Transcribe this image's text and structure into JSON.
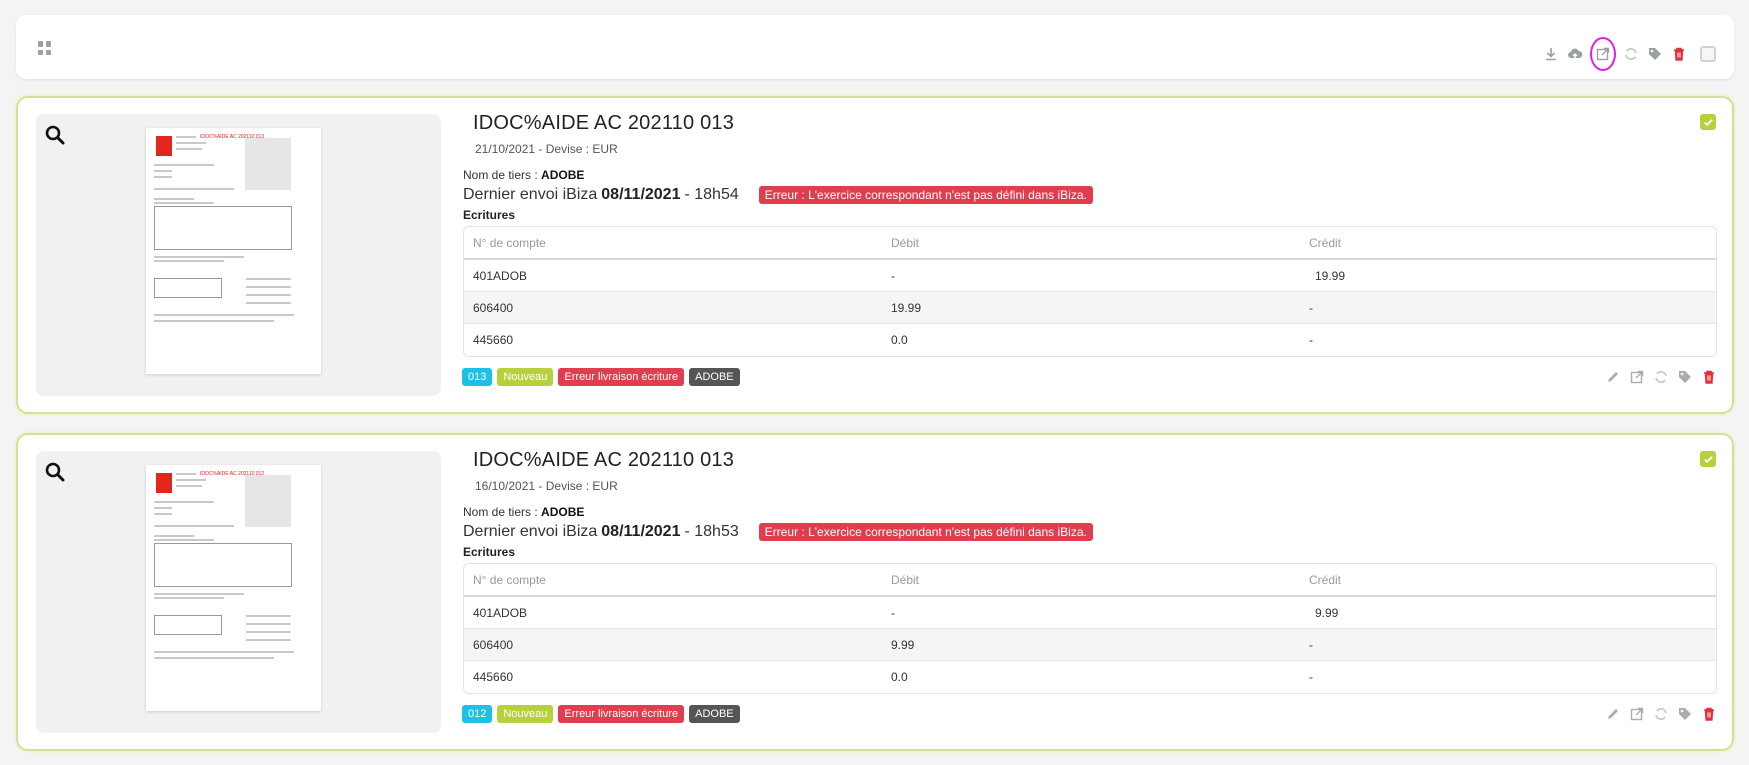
{
  "toolbar": {
    "icons": [
      "grid-icon",
      "download-icon",
      "cloud-upload-icon",
      "export-icon",
      "sync-icon",
      "tag-icon",
      "trash-icon"
    ]
  },
  "colors": {
    "accent_green": "#b7d03d",
    "error_red": "#e03e4f",
    "info_blue": "#1cc2e6",
    "dark_tag": "#555555",
    "highlight": "#e31ee3"
  },
  "cards": [
    {
      "title": "IDOC%AIDE AC 202110 013",
      "date": "21/10/2021",
      "devise_sep": " - Devise : ",
      "devise": "EUR",
      "tiers_label": "Nom de tiers : ",
      "tiers": "ADOBE",
      "last_send_label": "Dernier envoi iBiza",
      "last_send_date": "08/11/2021",
      "last_send_time": "- 18h54",
      "error": "Erreur : L'exercice correspondant n'est pas défini dans iBiza.",
      "ecritures_label": "Ecritures",
      "table_headers": [
        "N° de compte",
        "Débit",
        "Crédit"
      ],
      "rows": [
        [
          "401ADOB",
          "-",
          "19.99"
        ],
        [
          "606400",
          "19.99",
          "-"
        ],
        [
          "445660",
          "0.0",
          "-"
        ]
      ],
      "tags": [
        "013",
        "Nouveau",
        "Erreur livraison écriture",
        "ADOBE"
      ]
    },
    {
      "title": "IDOC%AIDE AC 202110 013",
      "date": "16/10/2021",
      "devise_sep": " - Devise : ",
      "devise": "EUR",
      "tiers_label": "Nom de tiers : ",
      "tiers": "ADOBE",
      "last_send_label": "Dernier envoi iBiza",
      "last_send_date": "08/11/2021",
      "last_send_time": "- 18h53",
      "error": "Erreur : L'exercice correspondant n'est pas défini dans iBiza.",
      "ecritures_label": "Ecritures",
      "table_headers": [
        "N° de compte",
        "Débit",
        "Crédit"
      ],
      "rows": [
        [
          "401ADOB",
          "-",
          "9.99"
        ],
        [
          "606400",
          "9.99",
          "-"
        ],
        [
          "445660",
          "0.0",
          "-"
        ]
      ],
      "tags": [
        "012",
        "Nouveau",
        "Erreur livraison écriture",
        "ADOBE"
      ]
    }
  ]
}
